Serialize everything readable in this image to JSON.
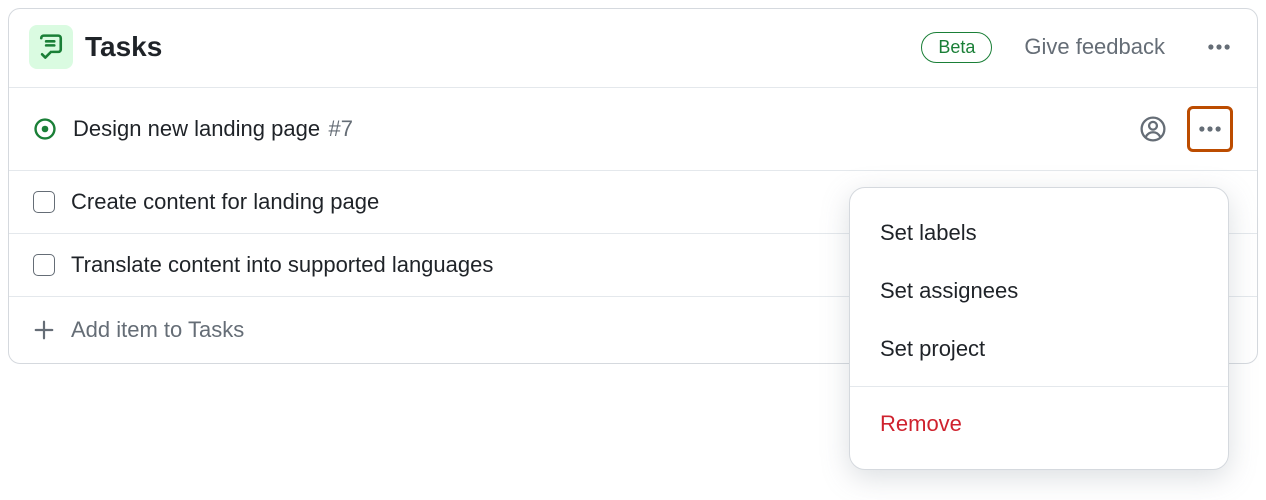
{
  "header": {
    "title": "Tasks",
    "badge": "Beta",
    "feedback": "Give feedback"
  },
  "tasks": [
    {
      "title": "Design new landing page",
      "ref": "#7"
    },
    {
      "title": "Create content for landing page"
    },
    {
      "title": "Translate content into supported languages"
    }
  ],
  "add_item_label": "Add item to Tasks",
  "menu": {
    "set_labels": "Set labels",
    "set_assignees": "Set assignees",
    "set_project": "Set project",
    "remove": "Remove"
  }
}
